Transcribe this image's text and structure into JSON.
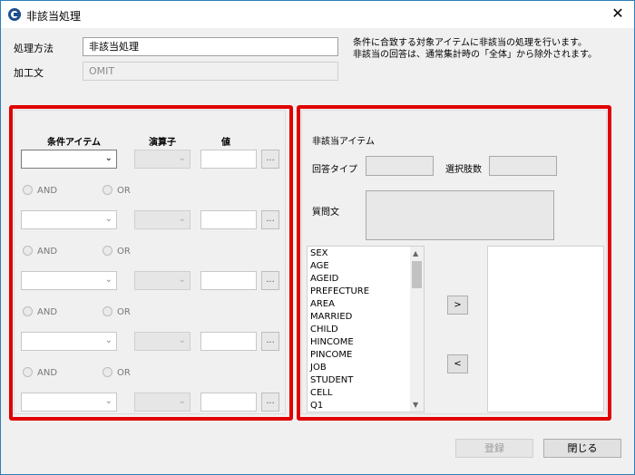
{
  "window": {
    "title": "非該当処理",
    "close_glyph": "✕"
  },
  "form": {
    "method_label": "処理方法",
    "method_value": "非該当処理",
    "process_label": "加工文",
    "process_value": "OMIT",
    "description_line1": "条件に合致する対象アイテムに非該当の処理を行います。",
    "description_line2": "非該当の回答は、通常集計時の「全体」から除外されます。"
  },
  "conditions": {
    "header_item": "条件アイテム",
    "header_operator": "演算子",
    "header_value": "値",
    "ellipsis": "...",
    "and_label": "AND",
    "or_label": "OR",
    "chevron": "⌄"
  },
  "target": {
    "header": "非該当アイテム",
    "answer_type_label": "回答タイプ",
    "choice_count_label": "選択肢数",
    "question_label": "質問文",
    "items": [
      "SEX",
      "AGE",
      "AGEID",
      "PREFECTURE",
      "AREA",
      "MARRIED",
      "CHILD",
      "HINCOME",
      "PINCOME",
      "JOB",
      "STUDENT",
      "CELL",
      "Q1"
    ],
    "scroll_up": "▲",
    "scroll_down": "▼",
    "add_button": ">",
    "remove_button": "<"
  },
  "footer": {
    "register_button": "登録",
    "close_button": "閉じる"
  },
  "colors": {
    "highlight": "#e00000",
    "title_accent": "#1e4f8c"
  }
}
